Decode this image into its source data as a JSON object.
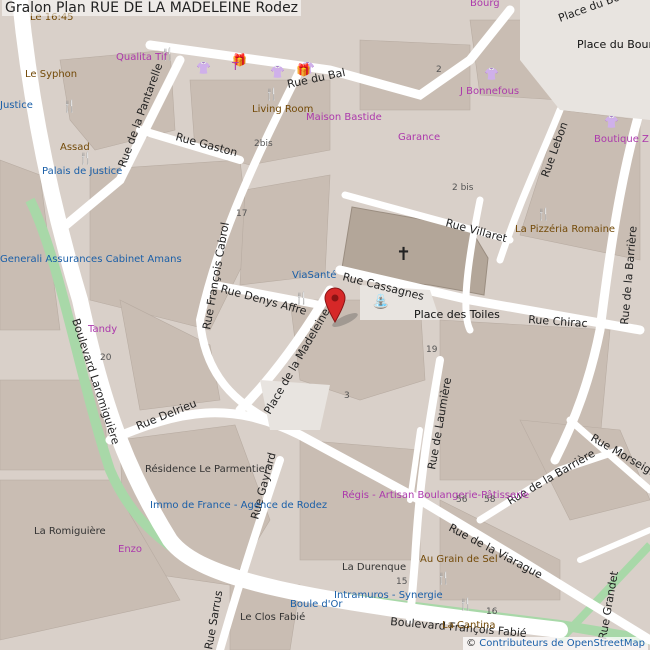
{
  "header": {
    "title": "Gralon Plan RUE DE LA MADELEINE Rodez"
  },
  "attribution": {
    "symbol": "©",
    "text": "Contributeurs de OpenStreetMap"
  },
  "colors": {
    "building": "#c9bdb3",
    "road": "#ffffff",
    "background": "#d9d0c9",
    "poi_shop": "#ac39ac",
    "poi_food": "#734a08",
    "poi_blue": "#0092da",
    "greenway": "#a8d8a8",
    "church": "#b3a699",
    "marker": "#d62828"
  },
  "marker": {
    "icon": "map-pin-icon",
    "label": "RUE DE LA MADELEINE"
  },
  "streets": [
    {
      "name": "Rue du Bal"
    },
    {
      "name": "Rue Gaston"
    },
    {
      "name": "Rue de la Pantarelle"
    },
    {
      "name": "Rue François Cabrol"
    },
    {
      "name": "Rue Denys Affre"
    },
    {
      "name": "Place de la Madeleine"
    },
    {
      "name": "Rue Cassagnes"
    },
    {
      "name": "Rue Villaret"
    },
    {
      "name": "Rue Chirac"
    },
    {
      "name": "Rue Lebon"
    },
    {
      "name": "Place du Bourg"
    },
    {
      "name": "Rue de la Barrière"
    },
    {
      "name": "Rue Delrieu"
    },
    {
      "name": "Boulevard Laromiguière"
    },
    {
      "name": "Rue de Laumière"
    },
    {
      "name": "Rue de la Barrière"
    },
    {
      "name": "Rue Morseigne"
    },
    {
      "name": "Rue de la Viarague"
    },
    {
      "name": "Rue Gayrard"
    },
    {
      "name": "Rue Sarrus"
    },
    {
      "name": "Boulevard François Fabié"
    },
    {
      "name": "Rue Grandet"
    }
  ],
  "squares": [
    {
      "name": "Place du Bourg"
    },
    {
      "name": "Place des Toiles"
    }
  ],
  "pois": [
    {
      "name": "Le 16:45",
      "type": "food"
    },
    {
      "name": "Bourg",
      "type": "shop"
    },
    {
      "name": "Le Syphon",
      "type": "food"
    },
    {
      "name": "Qualita Tif",
      "type": "shop"
    },
    {
      "name": "Living Room",
      "type": "food"
    },
    {
      "name": "Maison Bastide",
      "type": "shop"
    },
    {
      "name": "Garance",
      "type": "shop"
    },
    {
      "name": "J Bonnefous",
      "type": "shop"
    },
    {
      "name": "Boutique Z",
      "type": "shop"
    },
    {
      "name": "Assad",
      "type": "food"
    },
    {
      "name": "Palais de Justice",
      "type": "blue"
    },
    {
      "name": "Justice",
      "type": "blue"
    },
    {
      "name": "La Pizzéria Romaine",
      "type": "food"
    },
    {
      "name": "ViaSanté",
      "type": "blue"
    },
    {
      "name": "Generali Assurances Cabinet Amans",
      "type": "blue"
    },
    {
      "name": "Tandy",
      "type": "shop"
    },
    {
      "name": "Résidence Le Parmentier",
      "type": "plain"
    },
    {
      "name": "Immo de France - Agence de Rodez",
      "type": "blue"
    },
    {
      "name": "La Romiguière",
      "type": "plain"
    },
    {
      "name": "Enzo",
      "type": "shop"
    },
    {
      "name": "Régis - Artisan Boulangerie-Pâtisserie",
      "type": "shop"
    },
    {
      "name": "Au Grain de Sel",
      "type": "food"
    },
    {
      "name": "La Durenque",
      "type": "plain"
    },
    {
      "name": "Intramuros - Synergie",
      "type": "blue"
    },
    {
      "name": "Boule d'Or",
      "type": "blue"
    },
    {
      "name": "La Cantina",
      "type": "food"
    },
    {
      "name": "Le Clos Fabié",
      "type": "plain"
    }
  ],
  "house_numbers": [
    "2",
    "2bis",
    "17",
    "20",
    "19",
    "3",
    "56",
    "58",
    "15",
    "16",
    "2 bis"
  ]
}
